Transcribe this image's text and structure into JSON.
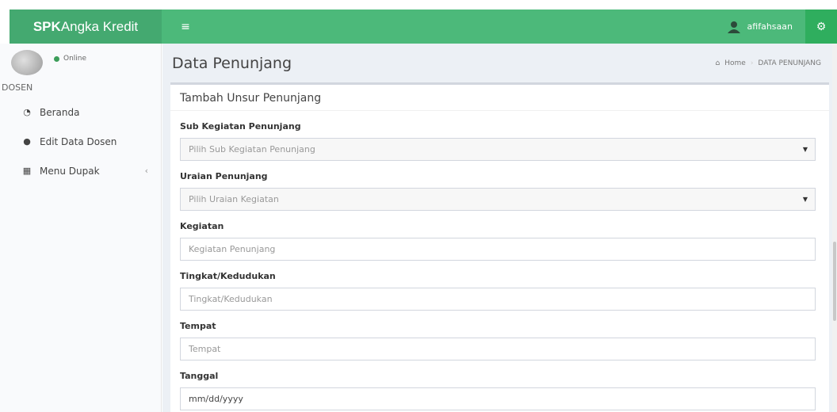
{
  "brand": {
    "bold": "SPK",
    "rest": "Angka Kredit"
  },
  "header": {
    "menu_icon": "hamburger-icon",
    "username": "afifahsaan",
    "settings_icon": "gears-icon"
  },
  "sidebar": {
    "status": "Online",
    "section": "DOSEN",
    "items": [
      {
        "label": "Beranda",
        "icon": "dashboard-icon"
      },
      {
        "label": "Edit Data Dosen",
        "icon": "user-icon"
      },
      {
        "label": "Menu Dupak",
        "icon": "table-icon"
      }
    ]
  },
  "page": {
    "title": "Data Penunjang",
    "breadcrumb_home": "Home",
    "breadcrumb_current": "DATA PENUNJANG"
  },
  "form": {
    "box_title": "Tambah Unsur Penunjang",
    "sub_kegiatan": {
      "label": "Sub Kegiatan Penunjang",
      "value": "Pilih Sub Kegiatan Penunjang"
    },
    "uraian": {
      "label": "Uraian Penunjang",
      "value": "Pilih Uraian Kegiatan"
    },
    "kegiatan": {
      "label": "Kegiatan",
      "placeholder": "Kegiatan Penunjang"
    },
    "tingkat": {
      "label": "Tingkat/Kedudukan",
      "placeholder": "Tingkat/Kedudukan"
    },
    "tempat": {
      "label": "Tempat",
      "placeholder": "Tempat"
    },
    "tanggal": {
      "label": "Tanggal",
      "value": "mm/dd/yyyy"
    }
  },
  "colors": {
    "topbar": "#4cb97a",
    "brand": "#44a970",
    "gear_button": "#2fae5e"
  }
}
